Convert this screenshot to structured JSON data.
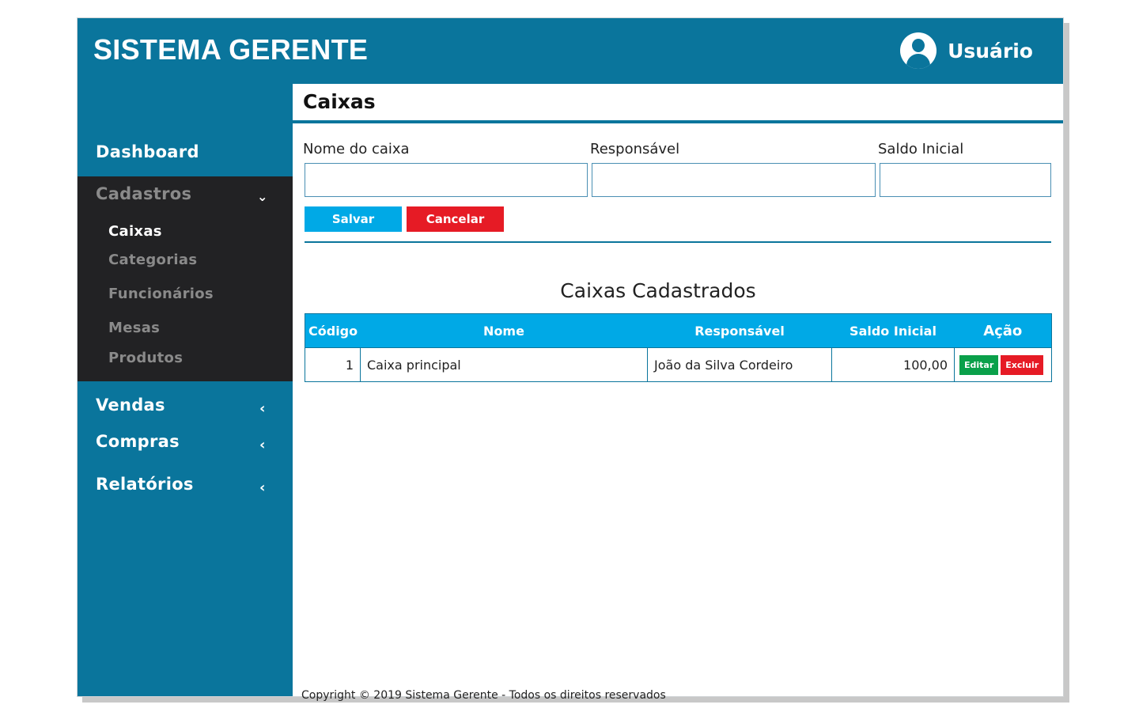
{
  "header": {
    "app_title": "SISTEMA GERENTE",
    "user_name": "Usuário",
    "user_icon": "user-avatar-icon"
  },
  "sidebar": {
    "dashboard": "Dashboard",
    "cadastros": {
      "label": "Cadastros",
      "items": [
        "Caixas",
        "Categorias",
        "Funcionários",
        "Mesas",
        "Produtos"
      ],
      "active": "Caixas"
    },
    "vendas": "Vendas",
    "compras": "Compras",
    "relatorios": "Relatórios",
    "expanded_arrow": "⌄",
    "collapsed_arrow": "‹"
  },
  "page": {
    "title": "Caixas"
  },
  "form": {
    "nome_label": "Nome do caixa",
    "nome_value": "",
    "responsavel_label": "Responsável",
    "responsavel_value": "",
    "saldo_label": "Saldo Inicial",
    "saldo_value": "",
    "save_label": "Salvar",
    "cancel_label": "Cancelar"
  },
  "table": {
    "title": "Caixas Cadastrados",
    "headers": [
      "Código",
      "Nome",
      "Responsável",
      "Saldo Inicial",
      "Ação"
    ],
    "rows": [
      {
        "codigo": "1",
        "nome": "Caixa principal",
        "responsavel": "João da Silva Cordeiro",
        "saldo": "100,00"
      }
    ],
    "edit_label": "Editar",
    "delete_label": "Excluir"
  },
  "footer": {
    "text": "Copyright © 2019 Sistema Gerente - Todos os direitos reservados"
  },
  "colors": {
    "primary": "#0a759c",
    "accent": "#00a9e6",
    "danger": "#e61b25",
    "success": "#0aa04a",
    "dark_menu": "#222224"
  }
}
